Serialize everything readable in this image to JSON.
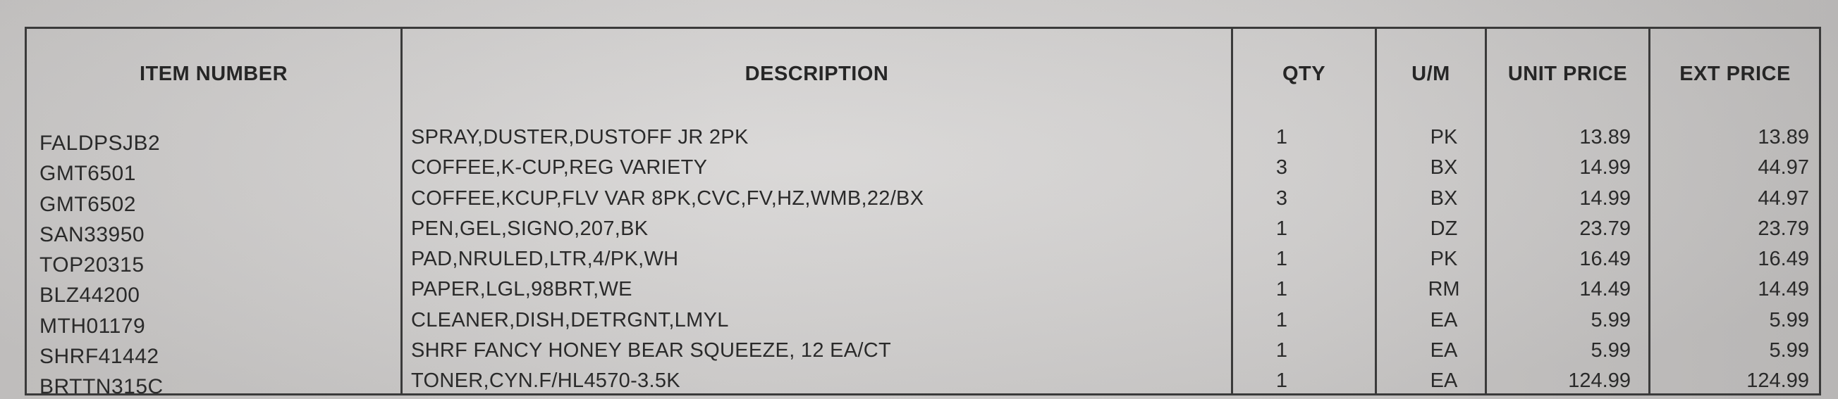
{
  "table": {
    "headers": {
      "item_number": "ITEM NUMBER",
      "description": "DESCRIPTION",
      "qty": "QTY",
      "um": "U/M",
      "unit_price": "UNIT PRICE",
      "ext_price": "EXT PRICE"
    },
    "rows": [
      {
        "item": "FALDPSJB2",
        "desc": "SPRAY,DUSTER,DUSTOFF JR 2PK",
        "qty": "1",
        "um": "PK",
        "unit": "13.89",
        "ext": "13.89"
      },
      {
        "item": "GMT6501",
        "desc": "COFFEE,K-CUP,REG VARIETY",
        "qty": "3",
        "um": "BX",
        "unit": "14.99",
        "ext": "44.97"
      },
      {
        "item": "GMT6502",
        "desc": "COFFEE,KCUP,FLV VAR 8PK,CVC,FV,HZ,WMB,22/BX",
        "qty": "3",
        "um": "BX",
        "unit": "14.99",
        "ext": "44.97"
      },
      {
        "item": "SAN33950",
        "desc": "PEN,GEL,SIGNO,207,BK",
        "qty": "1",
        "um": "DZ",
        "unit": "23.79",
        "ext": "23.79"
      },
      {
        "item": "TOP20315",
        "desc": "PAD,NRULED,LTR,4/PK,WH",
        "qty": "1",
        "um": "PK",
        "unit": "16.49",
        "ext": "16.49"
      },
      {
        "item": "BLZ44200",
        "desc": "PAPER,LGL,98BRT,WE",
        "qty": "1",
        "um": "RM",
        "unit": "14.49",
        "ext": "14.49"
      },
      {
        "item": "MTH01179",
        "desc": "CLEANER,DISH,DETRGNT,LMYL",
        "qty": "1",
        "um": "EA",
        "unit": "5.99",
        "ext": "5.99"
      },
      {
        "item": "SHRF41442",
        "desc": "SHRF FANCY HONEY BEAR SQUEEZE, 12 EA/CT",
        "qty": "1",
        "um": "EA",
        "unit": "5.99",
        "ext": "5.99"
      },
      {
        "item": "BRTTN315C",
        "desc": "TONER,CYN.F/HL4570-3.5K",
        "qty": "1",
        "um": "EA",
        "unit": "124.99",
        "ext": "124.99"
      }
    ]
  }
}
